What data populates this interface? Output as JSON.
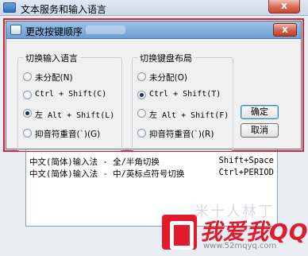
{
  "background_window": {
    "title": "文本服务和输入语言",
    "close_glyph": "x",
    "list_rows": [
      {
        "name": "中文(简体)输入法 - 全/半角切换",
        "keys": "Shift+Space"
      },
      {
        "name": "中文(简体)输入法 - 中/英标点符号切换",
        "keys": "Ctrl+PERIOD"
      }
    ],
    "watermark": "米十人林丁"
  },
  "dialog": {
    "title": "更改按键顺序",
    "close_glyph": "x",
    "input_language_group": {
      "legend": "切换输入语言",
      "options": [
        {
          "label": "未分配(N)",
          "checked": false
        },
        {
          "label": "Ctrl + Shift(C)",
          "checked": false
        },
        {
          "label": "左 Alt + Shift(L)",
          "checked": true
        },
        {
          "label": "抑音符重音(`)(G)",
          "checked": false
        }
      ]
    },
    "keyboard_layout_group": {
      "legend": "切换键盘布局",
      "options": [
        {
          "label": "未分配(O)",
          "checked": false
        },
        {
          "label": "Ctrl + Shift(T)",
          "checked": true
        },
        {
          "label": "左 Alt + Shift(F)",
          "checked": false
        },
        {
          "label": "抑音符重音(`)(R)",
          "checked": false
        }
      ]
    },
    "ok_label": "确定",
    "cancel_label": "取消"
  },
  "logo": {
    "text": "我爱我QQ",
    "url": "www.52mqyq.com"
  },
  "colors": {
    "highlight": "#e0202e",
    "title_bar": "#6d9ed3",
    "logo": "#e01b2c"
  }
}
